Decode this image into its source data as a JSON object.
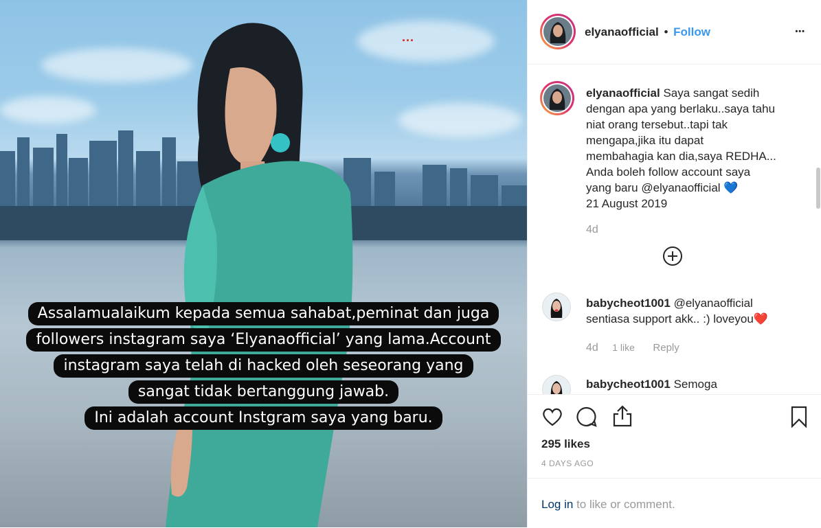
{
  "photo": {
    "red_dots": "...",
    "caption_lines": [
      "Assalamualaikum kepada semua sahabat,peminat dan juga",
      "followers instagram saya ‘Elyanaofficial’ yang lama.Account",
      "instagram saya telah di hacked oleh seseorang yang",
      "sangat tidak bertanggung jawab.",
      "Ini adalah account Instgram saya yang baru."
    ]
  },
  "header": {
    "username": "elyanaofficial",
    "separator": "•",
    "follow_label": "Follow",
    "more_label": "•••"
  },
  "post": {
    "username": "elyanaofficial",
    "caption_lines": [
      "Saya sangat sedih",
      "dengan apa yang berlaku..saya tahu",
      "niat orang tersebut..tapi tak",
      "mengapa,jika itu dapat",
      "membahagia kan dia,saya REDHA...",
      "Anda boleh follow account saya",
      "yang baru @elyanaofficial 💙",
      "21 August 2019"
    ],
    "age": "4d",
    "load_more_icon": "plus-circle-icon"
  },
  "comments": [
    {
      "username": "babycheot1001",
      "lines": [
        "@elyanaofficial",
        "sentiasa support akk.. :) loveyou❤️"
      ],
      "age": "4d",
      "likes": "1 like",
      "reply": "Reply"
    },
    {
      "username": "babycheot1001",
      "lines": [
        "Semoga"
      ]
    }
  ],
  "actions": {
    "likes": "295 likes",
    "timestamp": "4 DAYS AGO"
  },
  "login": {
    "link": "Log in",
    "rest": "to like or comment."
  },
  "colors": {
    "link_blue": "#3897f0",
    "text": "#262626",
    "muted": "#999999",
    "heart_red": "#ed4956"
  }
}
